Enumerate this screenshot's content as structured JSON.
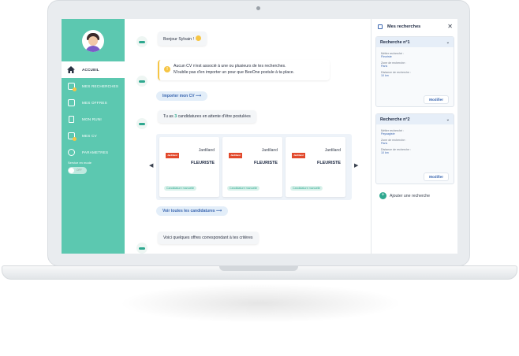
{
  "sidebar": {
    "items": [
      {
        "label": "ACCUEIL",
        "icon": "home-icon",
        "active": true
      },
      {
        "label": "MES RECHERCHES",
        "icon": "searches-icon"
      },
      {
        "label": "MES OFFRES",
        "icon": "offers-icon"
      },
      {
        "label": "MON RUNI",
        "icon": "document-icon"
      },
      {
        "label": "MES CV",
        "icon": "cv-icon"
      },
      {
        "label": "PARAMETRES",
        "icon": "settings-icon"
      }
    ],
    "service_label": "Service en mode",
    "toggle_text": "OFF"
  },
  "feed": {
    "greeting": "Bonjour Sylvain !",
    "warning_line1": "Aucun CV n'est associé à une ou plusieurs de tes recherches.",
    "warning_line2": "N'oublie pas d'en importer un pour que BeeOne postule à ta place.",
    "import_cv": "Importer mon CV ⟶",
    "candidatures_prefix": "Tu as",
    "candidatures_count": "3",
    "candidatures_suffix": "candidatures en attente d'être postulées",
    "see_all": "Voir toutes les candidatures ⟶",
    "offers_text": "Voici quelques offres correspondant à tes critères"
  },
  "cards": [
    {
      "logo": "Jardiland",
      "company": "Jardiland",
      "job": "FLEURISTE",
      "status": "Candidature manuelle"
    },
    {
      "logo": "Jardiland",
      "company": "Jardiland",
      "job": "FLEURISTE",
      "status": "Candidature manuelle"
    },
    {
      "logo": "Jardiland",
      "company": "Jardiland",
      "job": "FLEURISTE",
      "status": "Candidature manuelle"
    }
  ],
  "panel": {
    "title": "Mes recherches",
    "searches": [
      {
        "title": "Recherche n°1",
        "metier_label": "Métier recherché :",
        "metier": "Fleuriste",
        "zone_label": "Zone de recherche :",
        "zone": "Paris",
        "distance_label": "Distance de recherche :",
        "distance": "10 km",
        "modify": "Modifier"
      },
      {
        "title": "Recherche n°2",
        "metier_label": "Métier recherché :",
        "metier": "Paysagiste",
        "zone_label": "Zone de recherche :",
        "zone": "Paris",
        "distance_label": "Distance de recherche :",
        "distance": "10 km",
        "modify": "Modifier"
      }
    ],
    "add_search": "Ajouter une recherche"
  },
  "colors": {
    "accent": "#5cc8b0",
    "link": "#3a66b0",
    "warning": "#f6c544",
    "logo": "#e2492c"
  }
}
